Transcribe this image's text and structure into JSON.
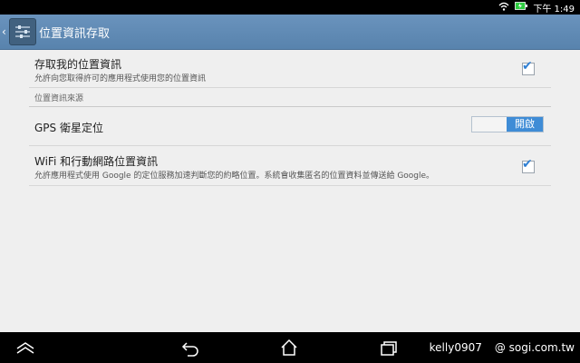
{
  "status": {
    "time": "下午 1:49"
  },
  "header": {
    "title": "位置資訊存取"
  },
  "settings": {
    "access": {
      "title": "存取我的位置資訊",
      "summary": "允許向您取得許可的應用程式使用您的位置資訊",
      "checked": true
    },
    "section_label": "位置資訊來源",
    "gps": {
      "title": "GPS 衛星定位",
      "switch_label": "開啟"
    },
    "wifi": {
      "title": "WiFi 和行動網路位置資訊",
      "summary": "允許應用程式使用 Google 的定位服務加速判斷您的約略位置。系統會收集匿名的位置資料並傳送給 Google。",
      "checked": true
    }
  },
  "watermark": {
    "user": "kelly0907",
    "site": "@ sogi.com.tw"
  },
  "icons": {
    "wifi": "wifi-icon",
    "battery": "battery-charging-icon",
    "back": "back-icon",
    "home": "home-icon",
    "recent": "recent-apps-icon",
    "collapse": "collapse-icon",
    "settings_app": "location-settings-icon"
  },
  "colors": {
    "actionbar": "#5f8ab5",
    "accent": "#3f8cd6",
    "background": "#efefef"
  }
}
